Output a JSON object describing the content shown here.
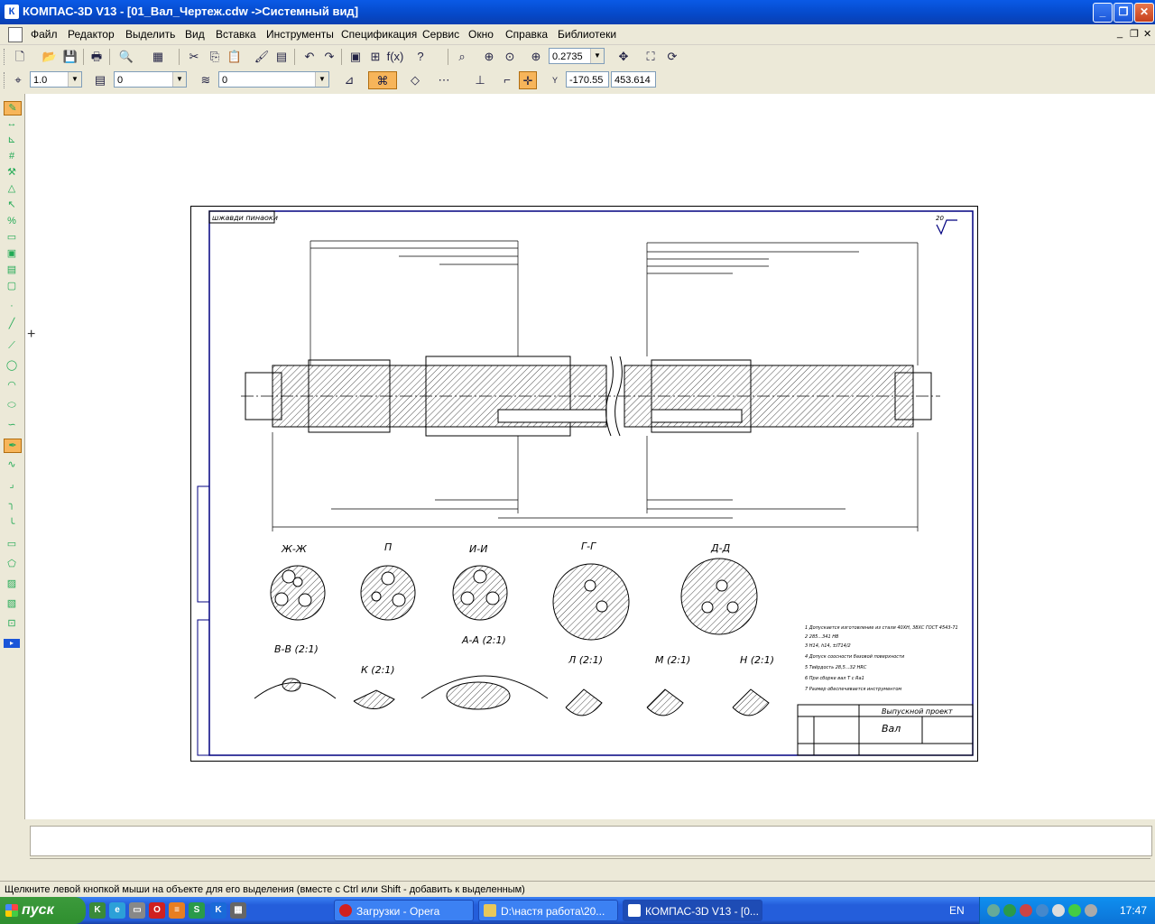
{
  "window": {
    "title": "КОМПАС-3D V13 - [01_Вал_Чертеж.cdw ->Системный вид]",
    "app_icon": "К",
    "minimize": "_",
    "maximize": "❐",
    "close": "✕"
  },
  "menu": {
    "items": [
      "Файл",
      "Редактор",
      "Выделить",
      "Вид",
      "Вставка",
      "Инструменты",
      "Спецификация",
      "Сервис",
      "Окно",
      "Справка",
      "Библиотеки"
    ],
    "mdi_controls": [
      "_",
      "❐",
      "✕"
    ]
  },
  "toolbar1": {
    "zoom_value": "0.2735"
  },
  "toolbar2": {
    "scale_value": "1.0",
    "layer_value": "0",
    "style_value": "0",
    "coord_x": "-170.55",
    "coord_y": "453.614"
  },
  "drawing": {
    "stamp_label": "шжавди пинаоки",
    "roughness": "20",
    "sections": [
      "Ж-Ж",
      "П",
      "И-И",
      "Г-Г",
      "Д-Д",
      "В-В (2:1)",
      "К (2:1)",
      "А-А (2:1)",
      "Л (2:1)",
      "М (2:1)",
      "Н (2:1)"
    ],
    "title_block": {
      "project": "Выпускной проект",
      "part_name": "Вал"
    },
    "notes": [
      "1 Допускается изготовление из стали 40ХН, 38ХС ГОСТ 4543-71",
      "2 285...341 НВ",
      "3 Н14, h14, ±IT14/2",
      "4 Допуск соосности базовой поверхности",
      "5 Твёрдость 28,5...32 HRC",
      "6 При сборке вал T с Ra1",
      "7 Размер обеспечивается инструментом"
    ]
  },
  "status": {
    "hint": "Щелкните левой кнопкой мыши на объекте для его выделения (вместе с Ctrl или Shift - добавить к выделенным)"
  },
  "taskbar": {
    "start_label": "пуск",
    "tasks": [
      {
        "label": "Загрузки - Opera"
      },
      {
        "label": "D:\\настя работа\\20..."
      },
      {
        "label": "КОМПАС-3D V13 - [0..."
      }
    ],
    "language": "EN",
    "clock": "17:47"
  },
  "colors": {
    "titlebar": "#0548c8",
    "taskbar": "#245edb",
    "start": "#2f8f2f",
    "active_tool": "#f7b55a",
    "drawing_line": "#000000",
    "sheet_border": "#000080"
  }
}
